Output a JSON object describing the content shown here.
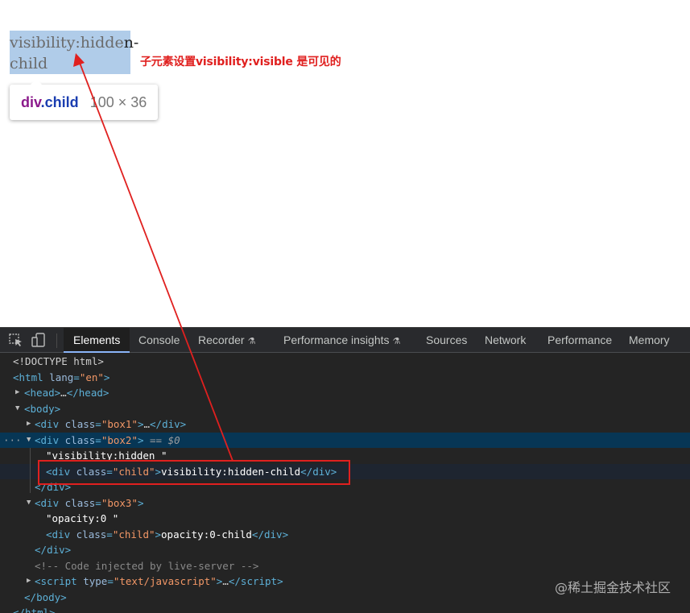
{
  "page": {
    "child_text_visible": "visibility:hidde",
    "child_text_tail": "n-",
    "child_text_line2": "child",
    "annotation": "子元素设置visibility:visible 是可见的"
  },
  "tooltip": {
    "tag": "div",
    "class": ".child",
    "size": "100 × 36"
  },
  "devtools": {
    "tabs": [
      {
        "label": "Elements",
        "active": true
      },
      {
        "label": "Console"
      },
      {
        "label": "Recorder",
        "flask": "⚗"
      },
      {
        "label": "Performance insights",
        "flask": "⚗"
      },
      {
        "label": "Sources"
      },
      {
        "label": "Network"
      },
      {
        "label": "Performance"
      },
      {
        "label": "Memory"
      }
    ],
    "tree": {
      "doctype": "<!DOCTYPE html>",
      "html_open": "<html",
      "html_lang_attr": "lang",
      "html_lang_val": "\"en\"",
      "head": "head",
      "body": "body",
      "div": "div",
      "class_attr": "class",
      "box1_val": "\"box1\"",
      "box2_val": "\"box2\"",
      "box3_val": "\"box3\"",
      "child_val": "\"child\"",
      "ellipsis": "…",
      "selected_marker": "== $0",
      "box2_text": "\"visibility:hidden \"",
      "box2_child_text": "visibility:hidden-child",
      "box3_text": "\"opacity:0 \"",
      "box3_child_text": "opacity:0-child",
      "comment": "<!-- Code injected by live-server -->",
      "script": "script",
      "type_attr": "type",
      "script_val": "\"text/javascript\"",
      "html_close": "</html>"
    }
  },
  "watermark": "@稀土掘金技术社区",
  "colors": {
    "annotation_red": "#e0201f",
    "selected_row": "#073655",
    "highlight": "#a7c7e7"
  }
}
